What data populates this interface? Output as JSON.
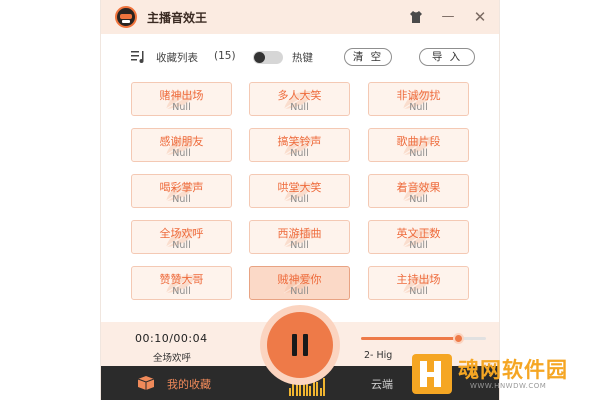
{
  "app": {
    "title": "主播音效王"
  },
  "toolbar": {
    "favorites_label": "收藏列表",
    "favorites_count": "(15)",
    "hotkey_label": "热键",
    "hotkey_enabled": false,
    "clear_label": "清 空",
    "import_label": "导 入"
  },
  "sounds": [
    {
      "name": "赌神出场",
      "sub": "Null"
    },
    {
      "name": "多人大笑",
      "sub": "Null"
    },
    {
      "name": "非诚勿扰",
      "sub": "Null"
    },
    {
      "name": "感谢朋友",
      "sub": "Null"
    },
    {
      "name": "搞笑铃声",
      "sub": "Null"
    },
    {
      "name": "歌曲片段",
      "sub": "Null"
    },
    {
      "name": "喝彩掌声",
      "sub": "Null"
    },
    {
      "name": "哄堂大笑",
      "sub": "Null"
    },
    {
      "name": "着音效果",
      "sub": "Null"
    },
    {
      "name": "全场欢呼",
      "sub": "Null"
    },
    {
      "name": "西游插曲",
      "sub": "Null"
    },
    {
      "name": "英文正数",
      "sub": "Null"
    },
    {
      "name": "赞赞大哥",
      "sub": "Null"
    },
    {
      "name": "贼神爱你",
      "sub": "Null",
      "active": true
    },
    {
      "name": "主持出场",
      "sub": "Null"
    }
  ],
  "player": {
    "time": "00:10/00:04",
    "now_playing": "全场欢呼",
    "volume": 0.78,
    "quality": "2-  Hig"
  },
  "bottom": {
    "my_favorites": "我的收藏",
    "cloud": "云端"
  },
  "watermark": {
    "name": "魂网软件园",
    "url": "WWW.HNWDW.COM"
  },
  "colors": {
    "accent": "#ee7a48",
    "title_bg": "#fbebe1",
    "bottom_bg": "#2b2b2b"
  }
}
